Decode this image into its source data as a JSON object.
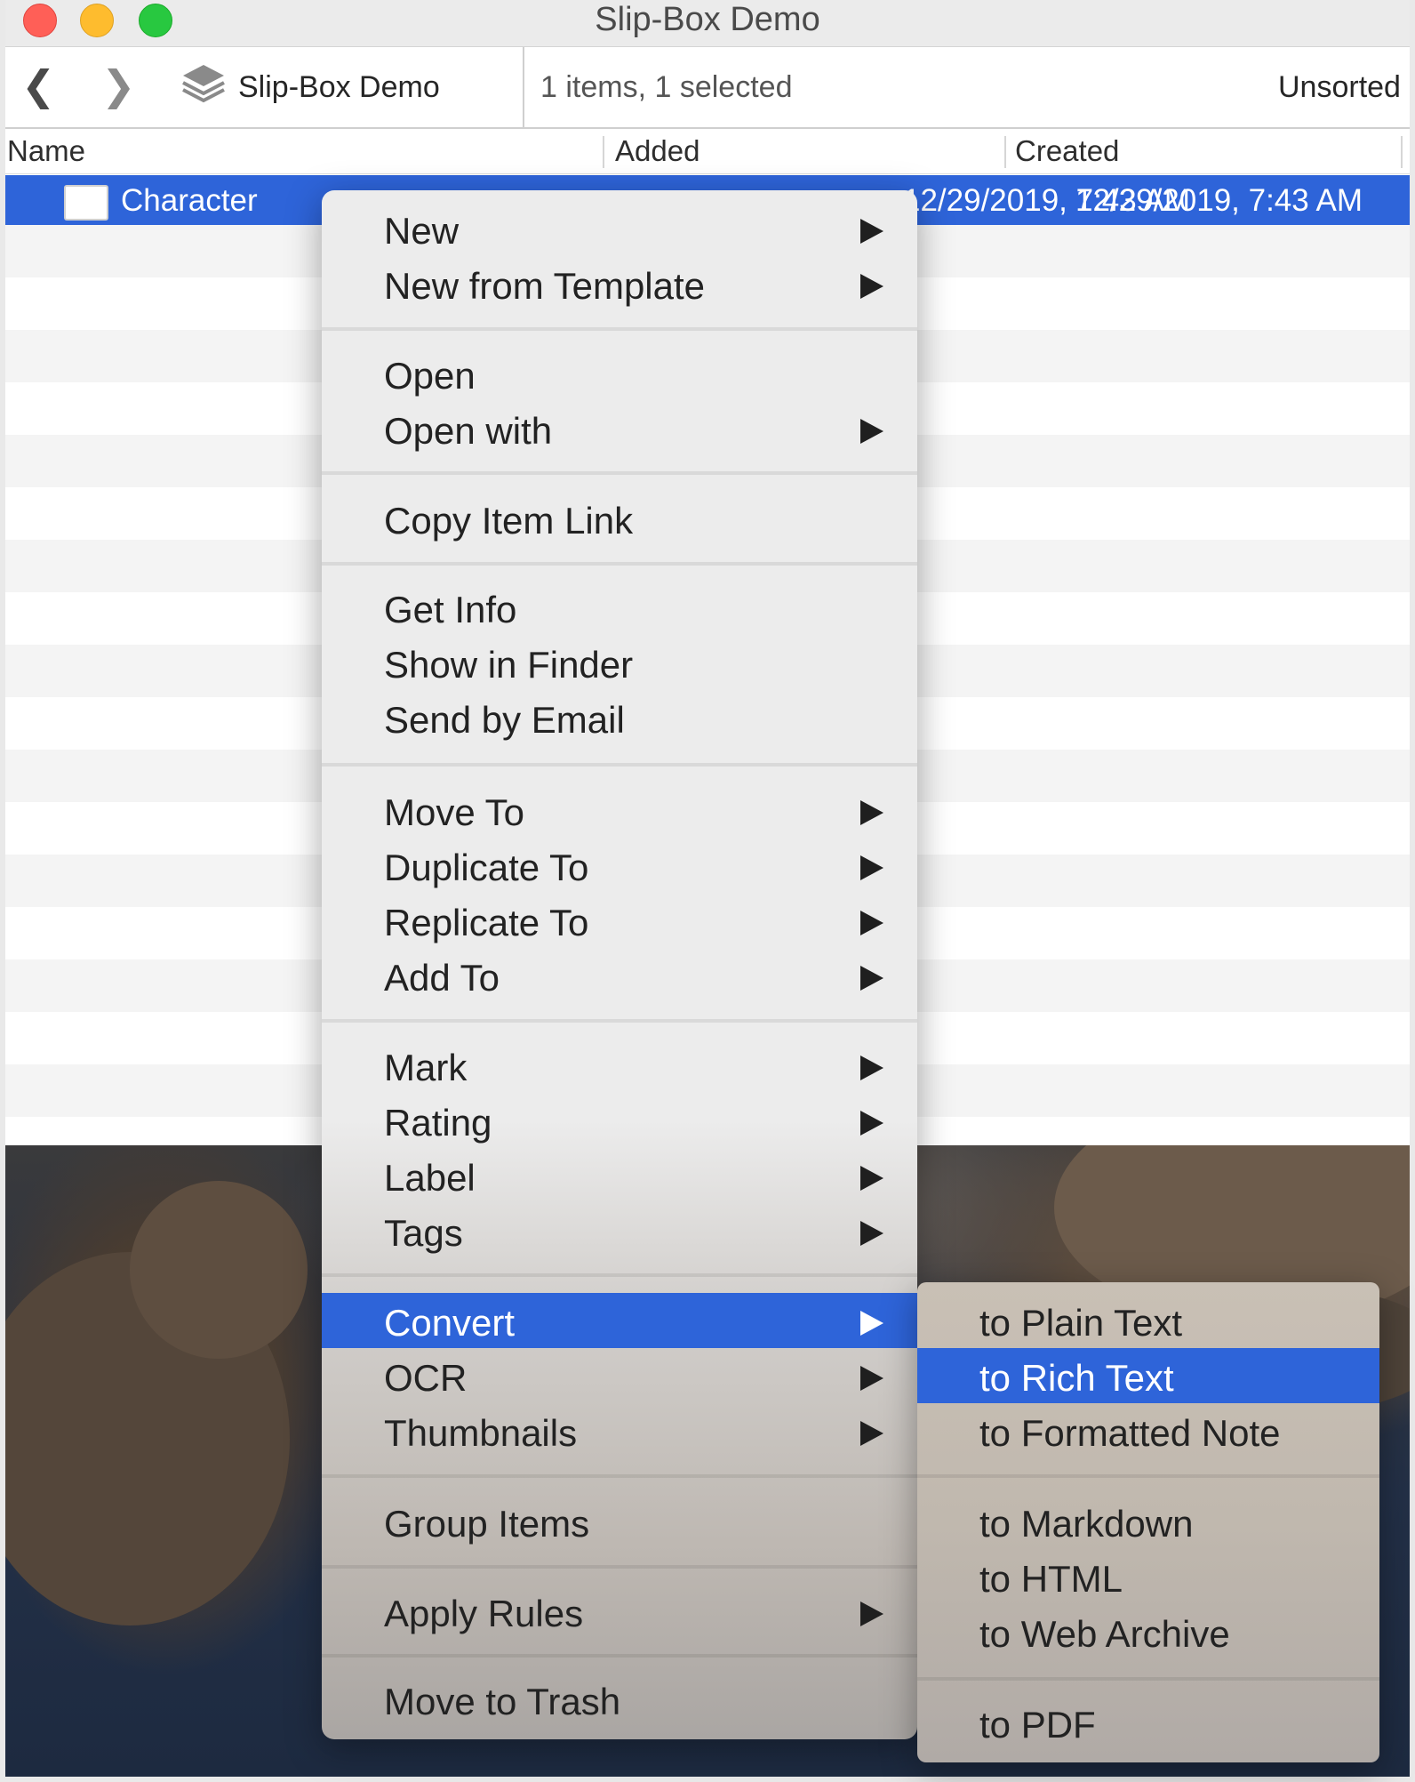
{
  "window": {
    "title": "Slip-Box Demo"
  },
  "toolbar": {
    "back_glyph": "❮",
    "forward_glyph": "❯",
    "database_name": "Slip-Box Demo",
    "status": "1 items, 1 selected",
    "sort_label": "Unsorted"
  },
  "columns": {
    "name": "Name",
    "added": "Added",
    "created": "Created"
  },
  "selected_row": {
    "name": "Character",
    "added": "12/29/2019, 7:43 AM",
    "created": "12/29/2019, 7:43 AM"
  },
  "context_menu": {
    "items": [
      {
        "label": "New",
        "submenu": true
      },
      {
        "label": "New from Template",
        "submenu": true
      },
      {
        "label": "Open",
        "submenu": false
      },
      {
        "label": "Open with",
        "submenu": true
      },
      {
        "label": "Copy Item Link",
        "submenu": false
      },
      {
        "label": "Get Info",
        "submenu": false
      },
      {
        "label": "Show in Finder",
        "submenu": false
      },
      {
        "label": "Send by Email",
        "submenu": false
      },
      {
        "label": "Move To",
        "submenu": true
      },
      {
        "label": "Duplicate To",
        "submenu": true
      },
      {
        "label": "Replicate To",
        "submenu": true
      },
      {
        "label": "Add To",
        "submenu": true
      },
      {
        "label": "Mark",
        "submenu": true
      },
      {
        "label": "Rating",
        "submenu": true
      },
      {
        "label": "Label",
        "submenu": true
      },
      {
        "label": "Tags",
        "submenu": true
      },
      {
        "label": "Convert",
        "submenu": true,
        "highlighted": true
      },
      {
        "label": "OCR",
        "submenu": true
      },
      {
        "label": "Thumbnails",
        "submenu": true
      },
      {
        "label": "Group Items",
        "submenu": false
      },
      {
        "label": "Apply Rules",
        "submenu": true
      },
      {
        "label": "Move to Trash",
        "submenu": false
      }
    ]
  },
  "convert_submenu": {
    "items": [
      {
        "label": "to Plain Text"
      },
      {
        "label": "to Rich Text",
        "highlighted": true
      },
      {
        "label": "to Formatted Note"
      },
      {
        "label": "to Markdown"
      },
      {
        "label": "to HTML"
      },
      {
        "label": "to Web Archive"
      },
      {
        "label": "to PDF"
      }
    ]
  },
  "colors": {
    "selection": "#2e64d9",
    "close": "#ff5f57",
    "minimize": "#febc2e",
    "maximize": "#28c840"
  }
}
